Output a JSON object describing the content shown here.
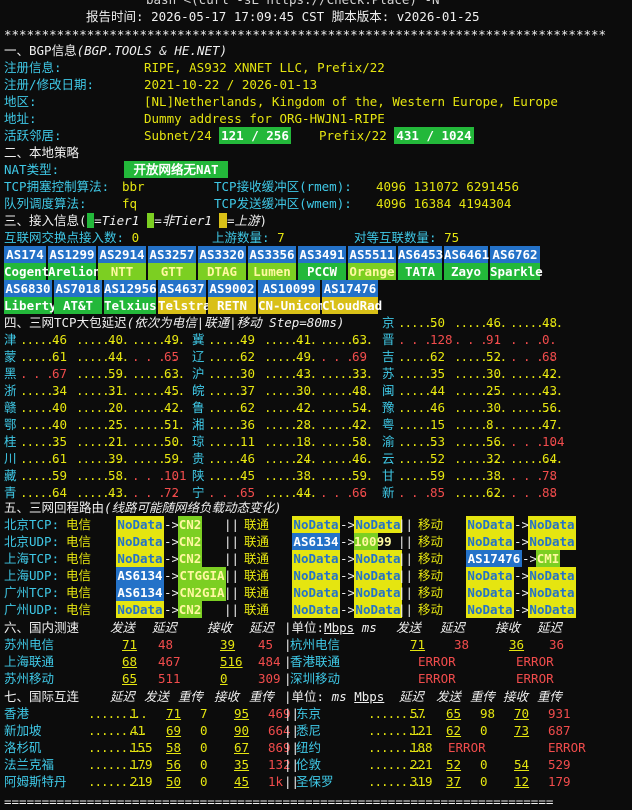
{
  "top": {
    "cmd": "bash <(curl -sL https://Check.Place) -N",
    "report_label": "报告时间:",
    "report_time": "2026-05-17 17:09:45 CST",
    "version_label": "脚本版本:",
    "version": "v2026-01-25"
  },
  "rule": "********************************************************************************",
  "bgp": {
    "title": "一、BGP信息",
    "subtitle": "(BGP.TOOLS & HE.NET)",
    "rows": [
      {
        "k": "注册信息:",
        "v": "RIPE, AS932 XNNET LLC, Prefix/22"
      },
      {
        "k": "注册/修改日期:",
        "v": "2021-10-22 / 2026-01-13"
      },
      {
        "k": "地区:",
        "v": "[NL]Netherlands, Kingdom of the, Western Europe, Europe"
      },
      {
        "k": "地址:",
        "v": "Dummy address for ORG-HWJN1-RIPE"
      }
    ],
    "neighbor_label": "活跃邻居:",
    "subnet_label": "Subnet/24",
    "subnet_val": "121 / 256",
    "prefix_label": "Prefix/22",
    "prefix_val": "431 / 1024"
  },
  "local": {
    "title": "二、本地策略",
    "nat_label": "NAT类型:",
    "nat_val": "开放网络无NAT",
    "tcp_cc_label": "TCP拥塞控制算法:",
    "tcp_cc": "bbr",
    "rmem_label": "TCP接收缓冲区(rmem):",
    "rmem": "4096 131072 6291456",
    "qdisc_label": "队列调度算法:",
    "qdisc": "fq",
    "wmem_label": "TCP发送缓冲区(wmem):",
    "wmem": "4096 16384 4194304"
  },
  "access": {
    "title": "三、接入信息",
    "legend1": "=Tier1",
    "legend2": "=非Tier1",
    "legend3": "=上游",
    "ixp_label": "互联网交换点接入数:",
    "ixp": "0",
    "upstream_label": "上游数量:",
    "upstream": "7",
    "peer_label": "对等互联数量:",
    "peer": "75",
    "row1": [
      {
        "as": "AS174",
        "name": "Cogent",
        "c": "G"
      },
      {
        "as": "AS1299",
        "name": "Arelion",
        "c": "G"
      },
      {
        "as": "AS2914",
        "name": "NTT",
        "c": "Gy"
      },
      {
        "as": "AS3257",
        "name": "GTT",
        "c": "Gy"
      },
      {
        "as": "AS3320",
        "name": "DTAG",
        "c": "Gy"
      },
      {
        "as": "AS3356",
        "name": "Lumen",
        "c": "Gy"
      },
      {
        "as": "AS3491",
        "name": "PCCW",
        "c": "G"
      },
      {
        "as": "AS5511",
        "name": "Orange",
        "c": "Gy"
      },
      {
        "as": "AS6453",
        "name": "TATA",
        "c": "G"
      },
      {
        "as": "AS6461",
        "name": "Zayo",
        "c": "G"
      },
      {
        "as": "AS6762",
        "name": "Sparkle",
        "c": "G"
      }
    ],
    "row2": [
      {
        "as": "AS6830",
        "name": "Liberty",
        "c": "G"
      },
      {
        "as": "AS7018",
        "name": "AT&T",
        "c": "G"
      },
      {
        "as": "AS12956",
        "name": "Telxius",
        "c": "G"
      },
      {
        "as": "AS4637",
        "name": "Telstra",
        "c": "Y"
      },
      {
        "as": "AS9002",
        "name": "RETN",
        "c": "Y"
      },
      {
        "as": "AS10099",
        "name": "CN-Unicom",
        "c": "Y"
      },
      {
        "as": "AS17476",
        "name": "CloudRad",
        "c": "Y"
      }
    ]
  },
  "tcp": {
    "title": "四、三网TCP大包延迟",
    "subtitle": "(依次为电信|联通|移动 Step=80ms)",
    "rows": [
      {
        "c": [
          {
            "p": "京",
            "v": [
              "50",
              "46",
              "48"
            ]
          }
        ]
      },
      {
        "c": [
          {
            "p": "津",
            "v": [
              "46",
              "40",
              "49"
            ]
          },
          {
            "p": "冀",
            "v": [
              "49",
              "41",
              "63"
            ]
          },
          {
            "p": "晋",
            "v": [
              "128",
              "91",
              "0"
            ]
          }
        ]
      },
      {
        "c": [
          {
            "p": "蒙",
            "v": [
              "61",
              "44",
              "65"
            ]
          },
          {
            "p": "辽",
            "v": [
              "62",
              "49",
              "69"
            ]
          },
          {
            "p": "吉",
            "v": [
              "62",
              "52",
              "68"
            ]
          }
        ]
      },
      {
        "c": [
          {
            "p": "黑",
            "v": [
              "67",
              "59",
              "63"
            ]
          },
          {
            "p": "沪",
            "v": [
              "30",
              "43",
              "33"
            ]
          },
          {
            "p": "苏",
            "v": [
              "35",
              "30",
              "42"
            ]
          }
        ]
      },
      {
        "c": [
          {
            "p": "浙",
            "v": [
              "34",
              "31",
              "45"
            ]
          },
          {
            "p": "皖",
            "v": [
              "37",
              "30",
              "48"
            ]
          },
          {
            "p": "闽",
            "v": [
              "44",
              "25",
              "43"
            ]
          }
        ]
      },
      {
        "c": [
          {
            "p": "赣",
            "v": [
              "40",
              "20",
              "42"
            ]
          },
          {
            "p": "鲁",
            "v": [
              "62",
              "42",
              "54"
            ]
          },
          {
            "p": "豫",
            "v": [
              "46",
              "30",
              "56"
            ]
          }
        ]
      },
      {
        "c": [
          {
            "p": "鄂",
            "v": [
              "40",
              "25",
              "51"
            ]
          },
          {
            "p": "湘",
            "v": [
              "36",
              "28",
              "42"
            ]
          },
          {
            "p": "粤",
            "v": [
              "15",
              "8",
              "47"
            ]
          }
        ]
      },
      {
        "c": [
          {
            "p": "桂",
            "v": [
              "35",
              "21",
              "50"
            ]
          },
          {
            "p": "琼",
            "v": [
              "11",
              "18",
              "58"
            ]
          },
          {
            "p": "渝",
            "v": [
              "53",
              "56",
              "104"
            ]
          }
        ]
      },
      {
        "c": [
          {
            "p": "川",
            "v": [
              "61",
              "39",
              "59"
            ]
          },
          {
            "p": "贵",
            "v": [
              "46",
              "24",
              "46"
            ]
          },
          {
            "p": "云",
            "v": [
              "52",
              "32",
              "64"
            ]
          }
        ]
      },
      {
        "c": [
          {
            "p": "藏",
            "v": [
              "59",
              "58",
              "101"
            ]
          },
          {
            "p": "陕",
            "v": [
              "45",
              "38",
              "59"
            ]
          },
          {
            "p": "甘",
            "v": [
              "59",
              "38",
              "78"
            ]
          }
        ]
      },
      {
        "c": [
          {
            "p": "青",
            "v": [
              "64",
              "43",
              "72"
            ]
          },
          {
            "p": "宁",
            "v": [
              "65",
              "44",
              "66"
            ]
          },
          {
            "p": "新",
            "v": [
              "85",
              "62",
              "88"
            ]
          }
        ]
      }
    ]
  },
  "route": {
    "title": "五、三网回程路由",
    "subtitle": "(线路可能随网络负载动态变化)",
    "rows": [
      {
        "k": "北京TCP:",
        "t": [
          [
            "NoData",
            "NA"
          ],
          [
            "CN2",
            "Gy"
          ]
        ],
        "u": [
          [
            "NoData",
            "NA"
          ],
          [
            "NoData",
            "NA"
          ]
        ],
        "m": [
          [
            "NoData",
            "NA"
          ],
          [
            "NoData",
            "NA"
          ]
        ]
      },
      {
        "k": "北京UDP:",
        "t": [
          [
            "NoData",
            "NA"
          ],
          [
            "CN2",
            "Gy"
          ]
        ],
        "u": [
          [
            "AS6134",
            "B"
          ],
          [
            "10099",
            "Gy"
          ]
        ],
        "m": [
          [
            "NoData",
            "NA"
          ],
          [
            "NoData",
            "NA"
          ]
        ]
      },
      {
        "k": "上海TCP:",
        "t": [
          [
            "NoData",
            "NA"
          ],
          [
            "CN2",
            "Gy"
          ]
        ],
        "u": [
          [
            "NoData",
            "NA"
          ],
          [
            "NoData",
            "NA"
          ]
        ],
        "m": [
          [
            "AS17476",
            "B"
          ],
          [
            "CMI",
            "Gy"
          ]
        ]
      },
      {
        "k": "上海UDP:",
        "t": [
          [
            "AS6134",
            "B"
          ],
          [
            "CTGGIA",
            "Gy"
          ]
        ],
        "u": [
          [
            "NoData",
            "NA"
          ],
          [
            "NoData",
            "NA"
          ]
        ],
        "m": [
          [
            "NoData",
            "NA"
          ],
          [
            "NoData",
            "NA"
          ]
        ]
      },
      {
        "k": "广州TCP:",
        "t": [
          [
            "AS6134",
            "B"
          ],
          [
            "CN2GIA",
            "Gy"
          ]
        ],
        "u": [
          [
            "NoData",
            "NA"
          ],
          [
            "NoData",
            "NA"
          ]
        ],
        "m": [
          [
            "NoData",
            "NA"
          ],
          [
            "NoData",
            "NA"
          ]
        ]
      },
      {
        "k": "广州UDP:",
        "t": [
          [
            "NoData",
            "NA"
          ],
          [
            "CN2",
            "Gy"
          ]
        ],
        "u": [
          [
            "NoData",
            "NA"
          ],
          [
            "NoData",
            "NA"
          ]
        ],
        "m": [
          [
            "NoData",
            "NA"
          ],
          [
            "NoData",
            "NA"
          ]
        ]
      }
    ],
    "isp_t": "电信",
    "isp_u": "联通",
    "isp_m": "移动",
    "sep": "||",
    "arrow": "->"
  },
  "dom": {
    "title": "六、国内测速",
    "h": [
      "发送",
      "延迟",
      "接收",
      "延迟"
    ],
    "unit": "|单位:",
    "mbps": "Mbps",
    "ms": "ms",
    "left": [
      {
        "n": "苏州电信",
        "s": "71",
        "l": "48",
        "r": "39",
        "l2": "45"
      },
      {
        "n": "上海联通",
        "s": "68",
        "l": "467",
        "r": "516",
        "l2": "484"
      },
      {
        "n": "苏州移动",
        "s": "65",
        "l": "511",
        "r": "0",
        "l2": "309"
      }
    ],
    "right": [
      {
        "n": "杭州电信",
        "s": "71",
        "l": "38",
        "r": "36",
        "l2": "36"
      },
      {
        "n": "香港联通",
        "err": "ERROR"
      },
      {
        "n": "深圳移动",
        "err": "ERROR"
      }
    ]
  },
  "intl": {
    "title": "七、国际互连",
    "h": [
      "延迟",
      "发送",
      "重传",
      "接收",
      "重传"
    ],
    "unit": "|单位:",
    "ms": "ms",
    "mbps": "Mbps",
    "left": [
      {
        "n": "香港",
        "d": "1",
        "s": "71",
        "r1": "7",
        "rv": "95",
        "r2": "469"
      },
      {
        "n": "新加坡",
        "d": "41",
        "s": "69",
        "r1": "0",
        "rv": "90",
        "r2": "664"
      },
      {
        "n": "洛杉矶",
        "d": "155",
        "s": "58",
        "r1": "0",
        "rv": "67",
        "r2": "869"
      },
      {
        "n": "法兰克福",
        "d": "179",
        "s": "56",
        "r1": "0",
        "rv": "35",
        "r2": "132"
      },
      {
        "n": "阿姆斯特丹",
        "d": "219",
        "s": "50",
        "r1": "0",
        "rv": "45",
        "r2": "1k"
      }
    ],
    "right": [
      {
        "n": "东京",
        "d": "57",
        "s": "65",
        "r1": "98",
        "rv": "70",
        "r2": "931"
      },
      {
        "n": "悉尼",
        "d": "121",
        "s": "62",
        "r1": "0",
        "rv": "73",
        "r2": "687"
      },
      {
        "n": "纽约",
        "d": "188",
        "err": "ERROR"
      },
      {
        "n": "伦敦",
        "d": "221",
        "s": "52",
        "r1": "0",
        "rv": "54",
        "r2": "529"
      },
      {
        "n": "圣保罗",
        "d": "319",
        "s": "37",
        "r1": "0",
        "rv": "12",
        "r2": "179"
      }
    ]
  }
}
